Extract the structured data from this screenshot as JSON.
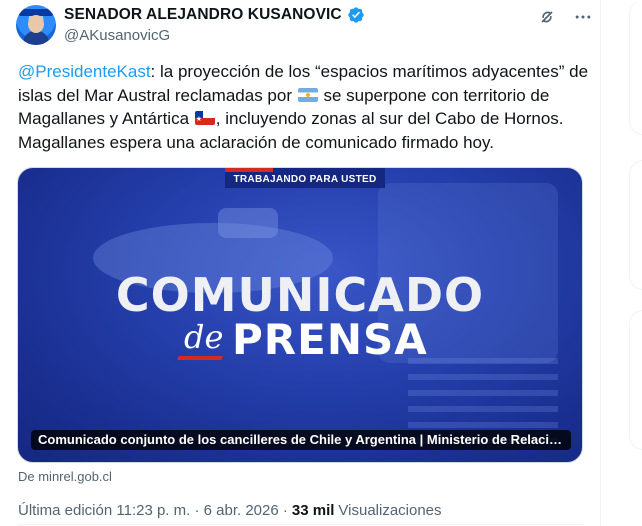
{
  "author": {
    "name": "SENADOR ALEJANDRO KUSANOVIC",
    "handle": "@AKusanovicG",
    "verified_color": "#1d9bf0"
  },
  "icons": {
    "grok": "grok-icon",
    "more": "more-icon",
    "verified": "verified-badge-icon"
  },
  "tweet": {
    "mention": "@PresidenteKast",
    "text_part1": ": la proyección de los “espacios marítimos adyacentes” de islas del Mar Austral reclamadas por ",
    "text_part2": " se superpone con territorio de Magallanes y Antártica ",
    "text_part3": ", incluyendo zonas al sur del Cabo de Hornos. Magallanes espera una aclaración de comunicado firmado hoy.",
    "flag_1": "argentina-flag",
    "flag_2": "chile-flag"
  },
  "card": {
    "banner": "TRABAJANDO PARA USTED",
    "headline_1": "COMUNICADO",
    "headline_de": "de",
    "headline_2": "PRENSA",
    "caption": "Comunicado conjunto de los cancilleres de Chile y Argentina | Ministerio de Relaciones Exteriores",
    "source": "De minrel.gob.cl",
    "colors": {
      "background": "#2540ad",
      "accent_red": "#d52b1e"
    }
  },
  "meta": {
    "edited": "Última edición 11:23 p. m. · 6 abr. 2026 · ",
    "views_count": "33 mil",
    "views_label": "Visualizaciones"
  },
  "colors": {
    "link": "#1d9bf0",
    "muted": "#536471",
    "text": "#0f1419"
  }
}
